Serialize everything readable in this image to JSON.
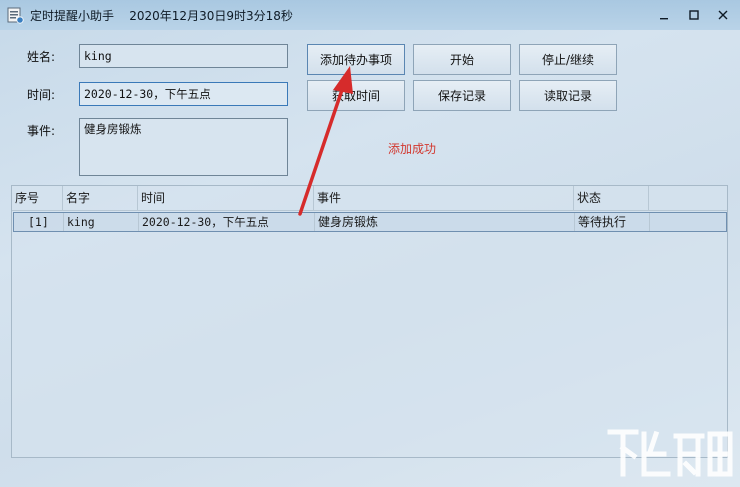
{
  "window": {
    "title": "定时提醒小助手    2020年12月30日9时3分18秒",
    "icons": {
      "app": "calendar-app-icon",
      "minimize": "minimize-icon",
      "maximize": "maximize-icon",
      "close": "close-icon"
    }
  },
  "form": {
    "name_label": "姓名:",
    "name_value": "king",
    "time_label": "时间:",
    "time_value": "2020-12-30，下午五点",
    "event_label": "事件:",
    "event_value": "健身房锻炼"
  },
  "buttons": {
    "add": "添加待办事项",
    "start": "开始",
    "stop": "停止/继续",
    "get_time": "获取时间",
    "save": "保存记录",
    "read": "读取记录"
  },
  "status_message": "添加成功",
  "table": {
    "headers": [
      "序号",
      "名字",
      "时间",
      "事件",
      "状态"
    ],
    "rows": [
      [
        "[1]",
        "king",
        "2020-12-30，下午五点",
        "健身房锻炼",
        "等待执行"
      ]
    ]
  },
  "colors": {
    "status_message": "#d2382f",
    "annotation_arrow": "#d62b2b",
    "title_bar": "#a9c8e1"
  }
}
